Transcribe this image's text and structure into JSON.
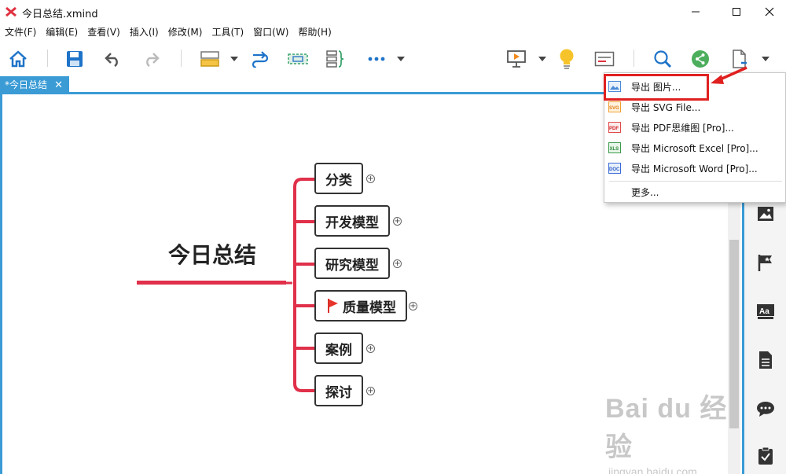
{
  "window": {
    "title": "今日总结.xmind"
  },
  "menu": {
    "items": [
      "文件(F)",
      "编辑(E)",
      "查看(V)",
      "插入(I)",
      "修改(M)",
      "工具(T)",
      "窗口(W)",
      "帮助(H)"
    ]
  },
  "tab": {
    "label": "*今日总结",
    "close": "✕"
  },
  "mindmap": {
    "central": "今日总结",
    "topics": [
      {
        "label": "分类",
        "flag": false
      },
      {
        "label": "开发模型",
        "flag": false
      },
      {
        "label": "研究模型",
        "flag": false
      },
      {
        "label": "质量模型",
        "flag": true
      },
      {
        "label": "案例",
        "flag": false
      },
      {
        "label": "探讨",
        "flag": false
      }
    ],
    "expand_symbol": "+"
  },
  "export_menu": {
    "items": [
      {
        "label": "导出 图片...",
        "icon": "image-file-icon"
      },
      {
        "label": "导出 SVG File...",
        "icon": "svg-file-icon"
      },
      {
        "label": "导出 PDF思维图 [Pro]...",
        "icon": "pdf-file-icon"
      },
      {
        "label": "导出 Microsoft Excel [Pro]...",
        "icon": "xls-file-icon"
      },
      {
        "label": "导出 Microsoft Word [Pro]...",
        "icon": "doc-file-icon"
      }
    ],
    "more": "更多..."
  },
  "colors": {
    "accent": "#3a9bd5",
    "branch": "#e0304a",
    "highlight": "#e02020"
  },
  "watermark": {
    "main": "Bai du 经验",
    "sub": "jingyan.baidu.com"
  }
}
